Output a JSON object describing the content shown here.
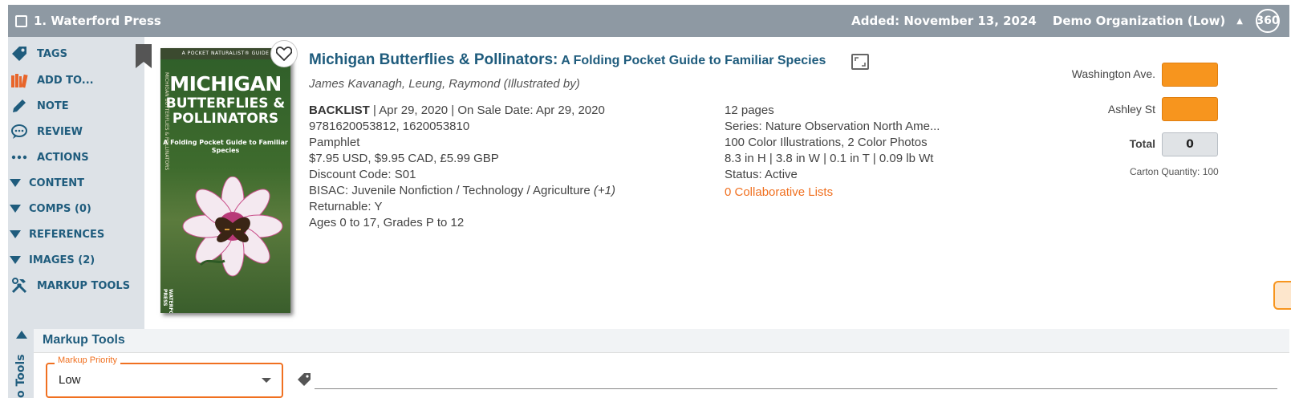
{
  "header": {
    "title": "1. Waterford Press",
    "added": "Added: November 13, 2024",
    "organization": "Demo Organization (Low)",
    "badge_360": "360"
  },
  "sidebar": {
    "items": [
      {
        "label": "TAGS",
        "icon": "tag-icon"
      },
      {
        "label": "ADD TO...",
        "icon": "books-icon"
      },
      {
        "label": "NOTE",
        "icon": "pencil-icon"
      },
      {
        "label": "REVIEW",
        "icon": "speech-bubble-icon"
      },
      {
        "label": "ACTIONS",
        "icon": "ellipsis-icon"
      },
      {
        "label": "CONTENT",
        "icon": "triangle-down-icon"
      },
      {
        "label": "COMPS (0)",
        "icon": "triangle-down-icon"
      },
      {
        "label": "REFERENCES",
        "icon": "triangle-down-icon"
      },
      {
        "label": "IMAGES (2)",
        "icon": "triangle-down-icon"
      },
      {
        "label": "MARKUP TOOLS",
        "icon": "tools-icon"
      }
    ]
  },
  "cover": {
    "top_banner": "A POCKET NATURALIST® GUIDE",
    "line1": "MICHIGAN",
    "line2": "BUTTERFLIES &",
    "line3": "POLLINATORS",
    "subtitle": "A Folding Pocket Guide to Familiar Species",
    "spine": "MICHIGAN BUTTERFLIES & POLLINATORS",
    "publisher": "WATERFORD PRESS"
  },
  "book": {
    "title": "Michigan Butterflies & Pollinators:",
    "subtitle": " A Folding Pocket Guide to Familiar Species",
    "authors": "James Kavanagh, Leung, Raymond (Illustrated by)",
    "left": {
      "status_label": "BACKLIST",
      "status_rest": " | Apr 29, 2020 | On Sale Date: Apr 29, 2020",
      "isbn": "9781620053812, 1620053810",
      "format": "Pamphlet",
      "price": "$7.95 USD, $9.95 CAD, £5.99 GBP",
      "discount": "Discount Code: S01",
      "bisac": "BISAC: Juvenile Nonfiction / Technology / Agriculture",
      "bisac_more": " (+1)",
      "returnable": "Returnable: Y",
      "ages": "Ages 0 to 17, Grades P to 12"
    },
    "right": {
      "pages": "12 pages",
      "series": "Series: Nature Observation North Ame...",
      "illustrations": "100 Color Illustrations, 2 Color Photos",
      "dimensions": "8.3 in H | 3.8 in W | 0.1 in T | 0.09 lb Wt",
      "status": "Status: Active",
      "collab": "0 Collaborative Lists"
    }
  },
  "order": {
    "locations": [
      "Washington Ave.",
      "Ashley St"
    ],
    "total_label": "Total",
    "total_value": "0",
    "carton": "Carton Quantity: 100"
  },
  "markup": {
    "title": "Markup Tools",
    "side_label": "o Tools",
    "priority_label": "Markup Priority",
    "priority_value": "Low"
  },
  "colors": {
    "header_bg": "#8e99a3",
    "sidebar_bg": "#dde2e7",
    "link_blue": "#1f5c7d",
    "accent_orange": "#f07020",
    "qty_orange": "#f7951e"
  }
}
